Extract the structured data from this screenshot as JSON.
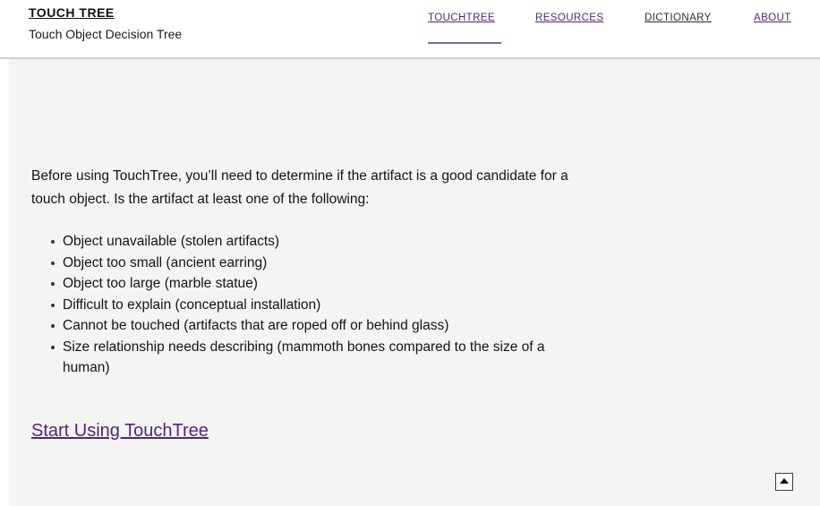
{
  "header": {
    "brand_title": "TOUCH TREE",
    "brand_subtitle": "Touch Object Decision Tree",
    "nav": [
      {
        "label": "TOUCHTREE",
        "color": "#4b2a7a",
        "active": true
      },
      {
        "label": "RESOURCES",
        "color": "#4b2a7a"
      },
      {
        "label": "DICTIONARY",
        "color": "#2b2b2b"
      },
      {
        "label": "ABOUT",
        "color": "#4b2a7a"
      }
    ]
  },
  "main": {
    "intro_text": "Before using TouchTree, you’ll need to determine if the artifact is a good candidate for a touch object. Is the artifact at least one of the following:",
    "criteria": [
      "Object unavailable (stolen artifacts)",
      "Object too small (ancient earring)",
      "Object too large (marble statue)",
      "Difficult to explain (conceptual installation)",
      "Cannot be touched (artifacts that are roped off or behind glass)",
      "Size relationship needs describing (mammoth bones compared to the size of a human)"
    ],
    "start_link": "Start Using TouchTree",
    "back_to_top_icon": "up-triangle-icon"
  },
  "colors": {
    "link_purple": "#4b2a7a",
    "content_background": "#f4f4f2",
    "header_divider": "#cfcfcf"
  }
}
